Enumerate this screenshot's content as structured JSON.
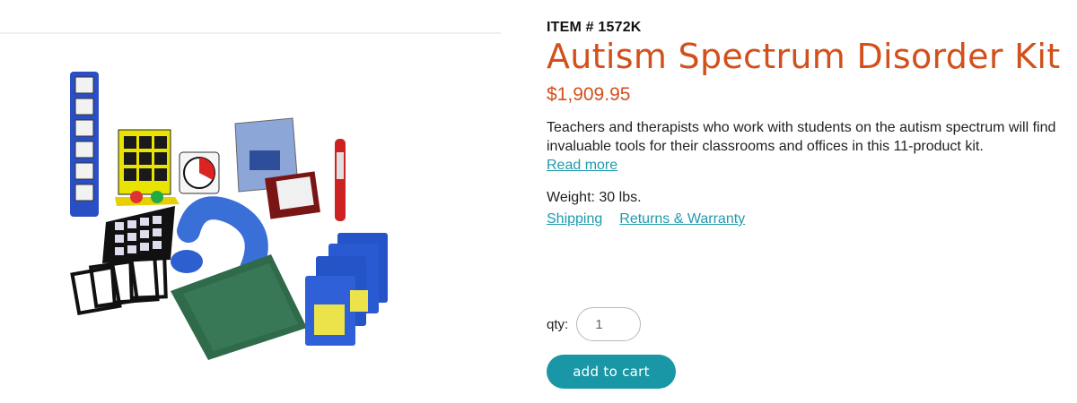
{
  "product": {
    "item_number": "ITEM # 1572K",
    "title": "Autism Spectrum Disorder Kit",
    "price": "$1,909.95",
    "description": "Teachers and therapists who work with students on the autism spectrum will find invaluable tools for their classrooms and offices in this 11-product kit.",
    "read_more": "Read more",
    "weight": "Weight: 30 lbs.",
    "image_alt": "Autism Spectrum Disorder Kit product photo"
  },
  "links": {
    "shipping": "Shipping",
    "returns": "Returns & Warranty"
  },
  "purchase": {
    "qty_label": "qty:",
    "qty_value": "1",
    "add_to_cart": "add to cart"
  },
  "colors": {
    "accent": "#d2501c",
    "link": "#1f9aad",
    "button": "#1a97a6"
  }
}
